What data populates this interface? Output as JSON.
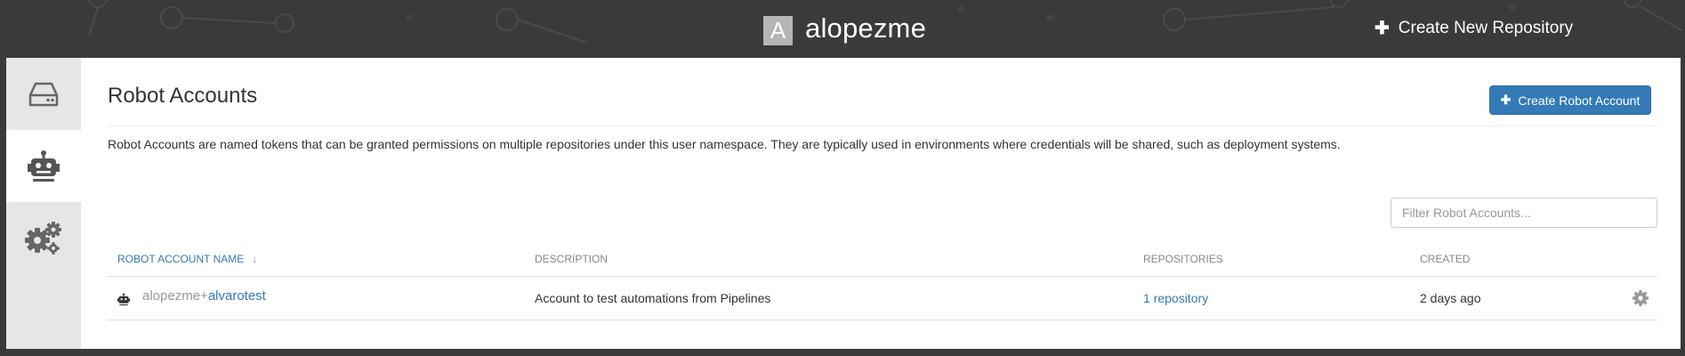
{
  "header": {
    "avatar_letter": "A",
    "namespace": "alopezme",
    "create_repo_label": "Create New Repository"
  },
  "sidebar": {
    "tabs": [
      {
        "icon": "hard-drive-icon",
        "active": false
      },
      {
        "icon": "robot-icon",
        "active": true
      },
      {
        "icon": "gears-icon",
        "active": false
      }
    ]
  },
  "main": {
    "title": "Robot Accounts",
    "create_button_label": "Create Robot Account",
    "description": "Robot Accounts are named tokens that can be granted permissions on multiple repositories under this user namespace. They are typically used in environments where credentials will be shared, such as deployment systems.",
    "filter_placeholder": "Filter Robot Accounts...",
    "table": {
      "columns": [
        "Robot Account Name",
        "Description",
        "Repositories",
        "Created"
      ],
      "rows": [
        {
          "namespace_prefix": "alopezme+",
          "name": "alvarotest",
          "description": "Account to test automations from Pipelines",
          "repositories": "1 repository",
          "created": "2 days ago"
        }
      ]
    }
  },
  "colors": {
    "accent": "#337ab7",
    "header_bg": "#3a3a3a",
    "sidebar_bg": "#e6e6e6"
  }
}
